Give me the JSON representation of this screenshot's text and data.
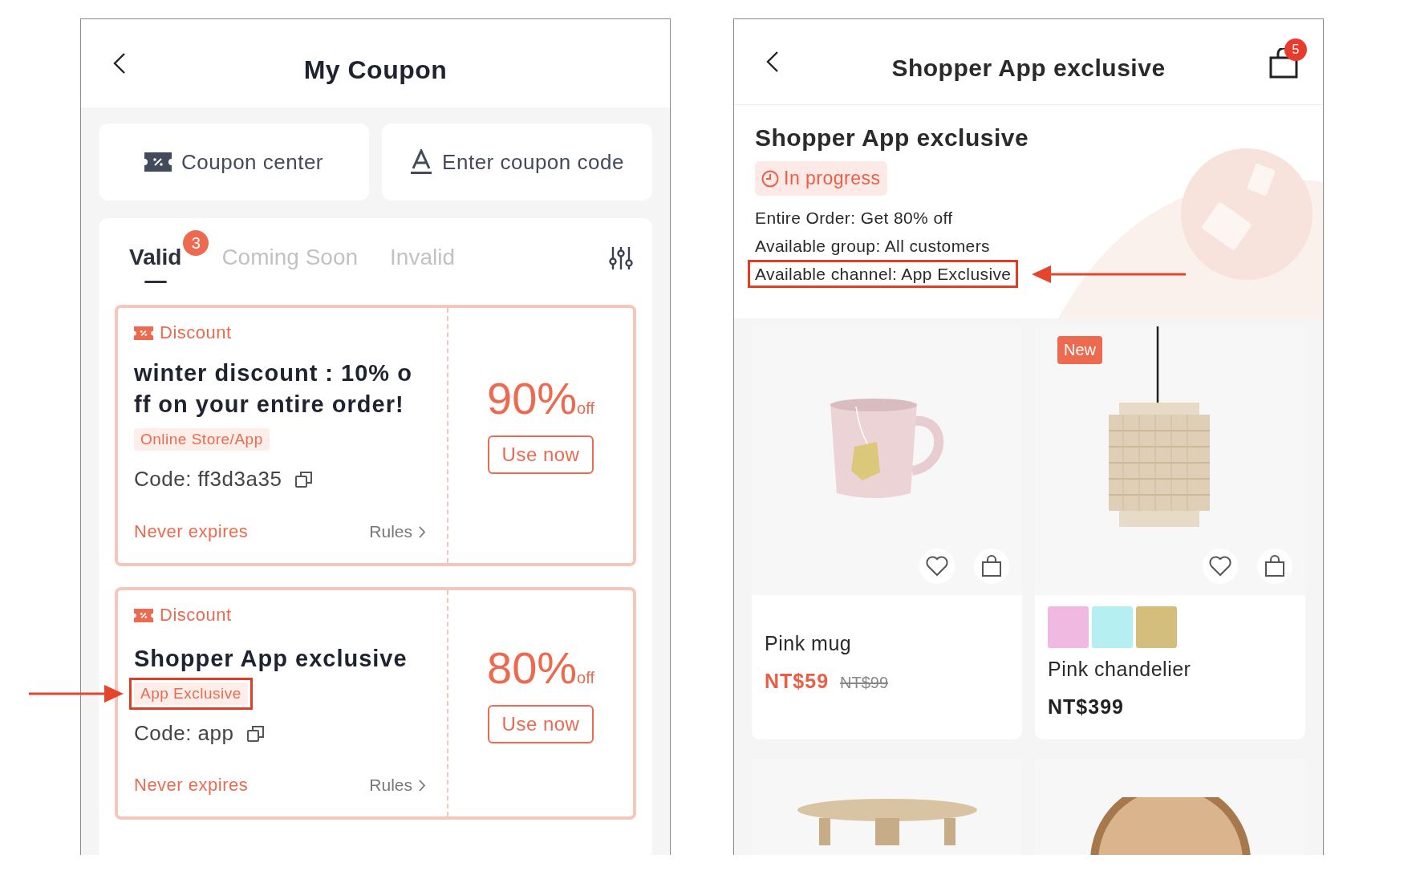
{
  "coupon_screen": {
    "title": "My Coupon",
    "actions": [
      {
        "kind": "center",
        "label": "Coupon center"
      },
      {
        "kind": "code",
        "label": "Enter coupon code"
      }
    ],
    "tabs": [
      {
        "label": "Valid",
        "selected": true,
        "badge": "3"
      },
      {
        "label": "Coming Soon",
        "selected": false
      },
      {
        "label": "Invalid",
        "selected": false
      }
    ],
    "coupons": [
      {
        "type": "Discount",
        "title": "winter discount : 10% o\nff on your entire order!",
        "channel": "Online Store/App",
        "highlighted": false,
        "code": "Code: ff3d3a35",
        "expiry": "Never expires",
        "rules": "Rules",
        "amount": "90%",
        "unit": "off",
        "button": "Use now"
      },
      {
        "type": "Discount",
        "title": "Shopper App exclusive",
        "channel": "App Exclusive",
        "highlighted": true,
        "code": "Code: app",
        "expiry": "Never expires",
        "rules": "Rules",
        "amount": "80%",
        "unit": "off",
        "button": "Use now"
      }
    ]
  },
  "promo_screen": {
    "title": "Shopper App exclusive",
    "cart_count": "5",
    "heading": "Shopper App exclusive",
    "status": "In progress",
    "details": [
      {
        "text": "Entire Order: Get 80% off",
        "highlighted": false
      },
      {
        "text": "Available group: All customers",
        "highlighted": false
      },
      {
        "text": "Available channel: App Exclusive",
        "highlighted": true
      }
    ],
    "products": [
      {
        "kind": "mug",
        "name": "Pink mug",
        "price": "NT$59",
        "old_price": "NT$99",
        "sale": true
      },
      {
        "kind": "lamp",
        "badge": "New",
        "swatches": [
          {
            "color": "#f0b9e1"
          },
          {
            "color": "#b5eff1"
          },
          {
            "color": "#d4be7e"
          }
        ],
        "name": "Pink chandelier",
        "price": "NT$399",
        "sale": false
      }
    ],
    "more_products": [
      {
        "kind": "table"
      },
      {
        "kind": "clock"
      }
    ]
  }
}
